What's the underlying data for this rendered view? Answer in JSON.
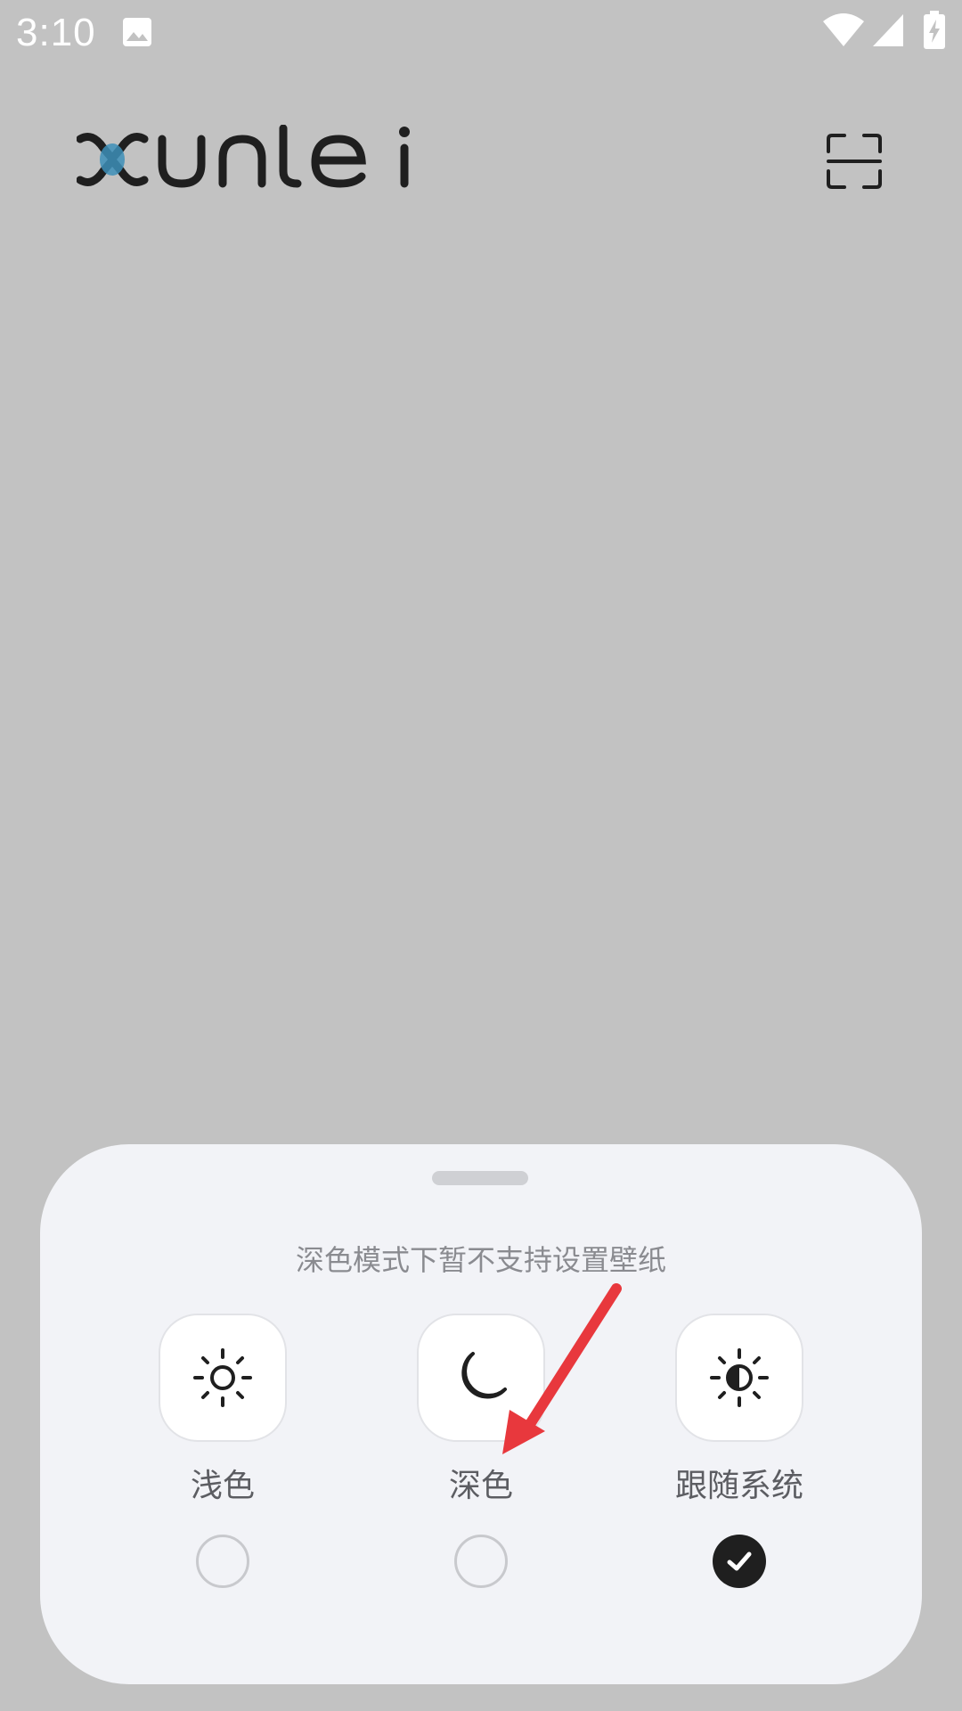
{
  "status_bar": {
    "time": "3:10",
    "icons": [
      "image-icon",
      "wifi-icon",
      "signal-icon",
      "battery-charging-icon"
    ]
  },
  "header": {
    "logo_text": "xunlei",
    "scan_icon": "scan-icon"
  },
  "sheet": {
    "notice": "深色模式下暂不支持设置壁纸",
    "options": [
      {
        "label": "浅色",
        "icon": "sun-icon",
        "selected": false
      },
      {
        "label": "深色",
        "icon": "moon-icon",
        "selected": false
      },
      {
        "label": "跟随系统",
        "icon": "half-sun-icon",
        "selected": true
      }
    ]
  },
  "colors": {
    "background": "#c2c2c2",
    "sheet": "#f2f3f7",
    "selected_radio": "#1f1f1f",
    "annotation_arrow": "#e8383d"
  }
}
